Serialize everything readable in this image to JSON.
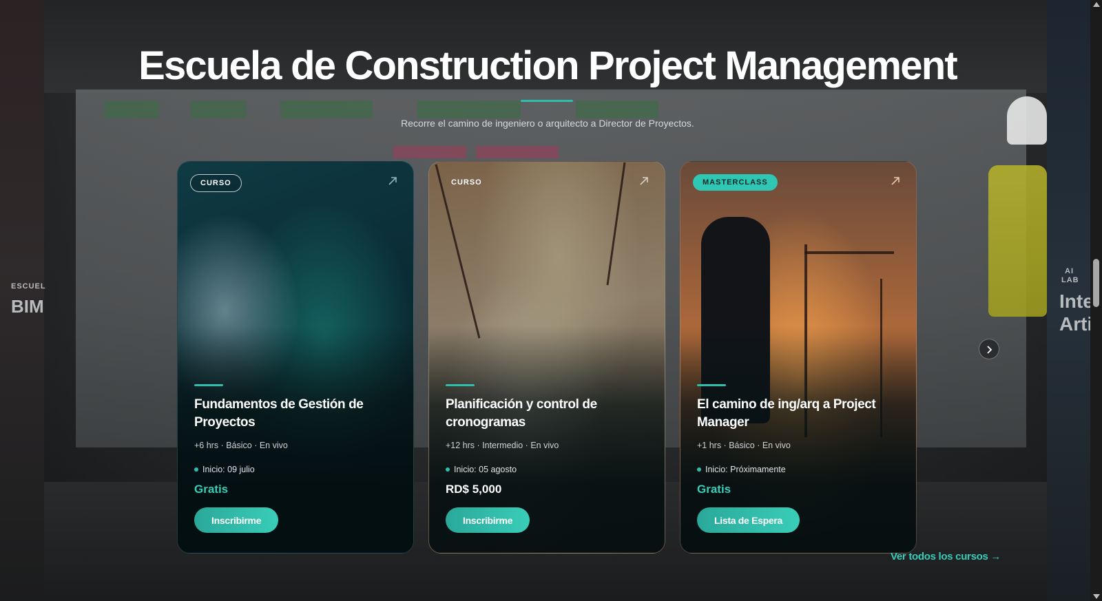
{
  "colors": {
    "accent": "#2dbfae",
    "price_free": "#36cdb9",
    "background": "#151617"
  },
  "header": {
    "title": "Escuela de Construction Project Management",
    "subtitle": "Recorre el camino de ingeniero o arquitecto a Director de Proyectos."
  },
  "side_left": {
    "label": "ESCUEL",
    "title": "BIM"
  },
  "side_right": {
    "label_line1": "AI",
    "label_line2": "LAB",
    "title_line1": "Inte",
    "title_line2": "Arti"
  },
  "cards": [
    {
      "badge": "CURSO",
      "title": "Fundamentos de Gestión de Proyectos",
      "meta": "+6 hrs · Básico · En vivo",
      "start": "Inicio: 09 julio",
      "price": "Gratis",
      "button": "Inscribirme",
      "icon": "arrow-up-right-icon"
    },
    {
      "badge": "CURSO",
      "title": "Planificación y control de cronogramas",
      "meta": "+12 hrs · Intermedio · En vivo",
      "start": "Inicio: 05 agosto",
      "price": "RD$ 5,000",
      "button": "Inscribirme",
      "icon": "arrow-up-right-icon"
    },
    {
      "badge": "MASTERCLASS",
      "title": "El camino de ing/arq a Project Manager",
      "meta": "+1 hrs · Básico · En vivo",
      "start": "Inicio: Próximamente",
      "price": "Gratis",
      "button": "Lista de Espera",
      "icon": "arrow-up-right-icon"
    }
  ],
  "carousel": {
    "next_icon": "chevron-right-icon"
  },
  "footer_link": {
    "label": "Ver todos los cursos →"
  }
}
